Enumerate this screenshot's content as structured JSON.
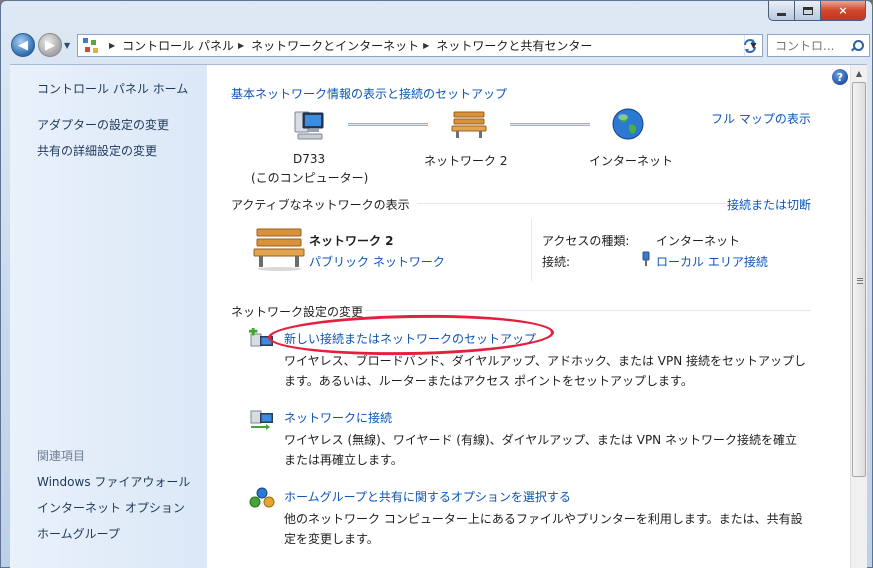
{
  "window": {
    "controls": {
      "minimize": "minimize",
      "maximize": "maximize",
      "close": "×"
    },
    "accent": "#0b54b5"
  },
  "navigation": {
    "back_icon": "back-arrow-icon",
    "forward_icon": "forward-arrow-icon",
    "breadcrumb": [
      "コントロール パネル",
      "ネットワークとインターネット",
      "ネットワークと共有センター"
    ],
    "search_placeholder": "コントロ..."
  },
  "sidebar": {
    "home_link": "コントロール パネル ホーム",
    "links": [
      "アダプターの設定の変更",
      "共有の詳細設定の変更"
    ],
    "related_heading": "関連項目",
    "related_links": [
      "Windows ファイアウォール",
      "インターネット オプション",
      "ホームグループ"
    ]
  },
  "main": {
    "heading": "基本ネットワーク情報の表示と接続のセットアップ",
    "full_map_link": "フル マップの表示",
    "map": {
      "computer_name": "D733",
      "computer_sub": "(このコンピューター)",
      "network_name": "ネットワーク  2",
      "internet": "インターネット"
    },
    "active": {
      "heading": "アクティブなネットワークの表示",
      "connect_link": "接続または切断",
      "network_name": "ネットワーク  2",
      "network_type": "パブリック ネットワーク",
      "access_label": "アクセスの種類:",
      "access_value": "インターネット",
      "connection_label": "接続:",
      "connection_value": "ローカル エリア接続"
    },
    "change": {
      "heading": "ネットワーク設定の変更",
      "tasks": [
        {
          "title": "新しい接続またはネットワークのセットアップ",
          "desc1": "ワイヤレス、ブロードバンド、ダイヤルアップ、アドホック、または VPN 接続をセットアップし",
          "desc2": "ます。あるいは、ルーターまたはアクセス ポイントをセットアップします。"
        },
        {
          "title": "ネットワークに接続",
          "desc1": "ワイヤレス (無線)、ワイヤード (有線)、ダイヤルアップ、または VPN ネットワーク接続を確立",
          "desc2": "または再確立します。"
        },
        {
          "title": "ホームグループと共有に関するオプションを選択する",
          "desc1": "他のネットワーク コンピューター上にあるファイルやプリンターを利用します。または、共有設",
          "desc2": "定を変更します。"
        }
      ]
    }
  }
}
